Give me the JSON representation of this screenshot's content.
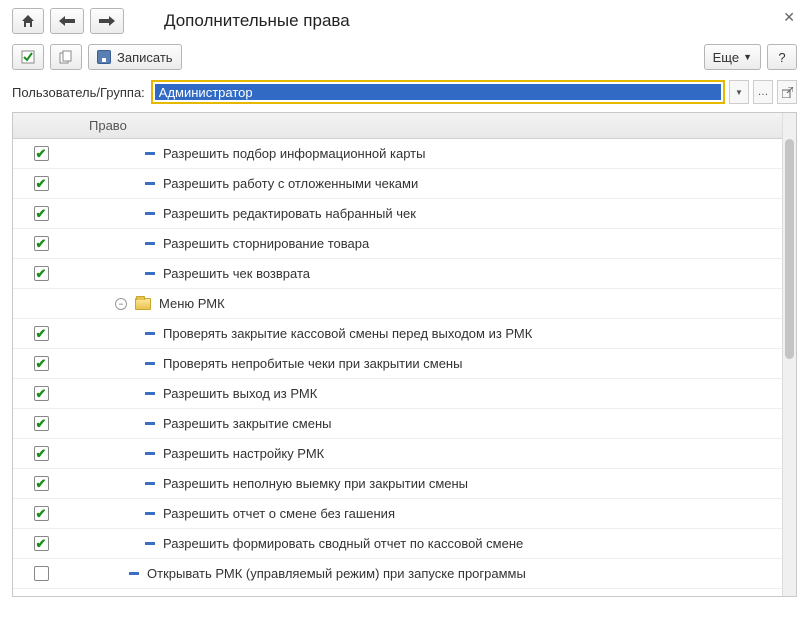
{
  "window": {
    "title": "Дополнительные права"
  },
  "toolbar": {
    "save_label": "Записать",
    "more_label": "Еще"
  },
  "user": {
    "label": "Пользователь/Группа:",
    "value": "Администратор"
  },
  "grid": {
    "header_right": "Право",
    "rows": [
      {
        "type": "leaf",
        "checked": true,
        "indent": 1,
        "label": "Разрешить подбор информационной карты"
      },
      {
        "type": "leaf",
        "checked": true,
        "indent": 1,
        "label": "Разрешить работу с отложенными чеками"
      },
      {
        "type": "leaf",
        "checked": true,
        "indent": 1,
        "label": "Разрешить редактировать набранный чек"
      },
      {
        "type": "leaf",
        "checked": true,
        "indent": 1,
        "label": "Разрешить сторнирование товара"
      },
      {
        "type": "leaf",
        "checked": true,
        "indent": 1,
        "label": "Разрешить чек возврата"
      },
      {
        "type": "folder",
        "label": "Меню РМК",
        "expanded": true
      },
      {
        "type": "leaf",
        "checked": true,
        "indent": 2,
        "label": "Проверять закрытие кассовой смены перед выходом из РМК"
      },
      {
        "type": "leaf",
        "checked": true,
        "indent": 2,
        "label": "Проверять непробитые чеки при закрытии смены"
      },
      {
        "type": "leaf",
        "checked": true,
        "indent": 2,
        "label": "Разрешить выход из РМК"
      },
      {
        "type": "leaf",
        "checked": true,
        "indent": 2,
        "label": "Разрешить закрытие смены"
      },
      {
        "type": "leaf",
        "checked": true,
        "indent": 2,
        "label": "Разрешить настройку РМК"
      },
      {
        "type": "leaf",
        "checked": true,
        "indent": 2,
        "label": "Разрешить неполную выемку при закрытии смены"
      },
      {
        "type": "leaf",
        "checked": true,
        "indent": 2,
        "label": "Разрешить отчет о смене без гашения"
      },
      {
        "type": "leaf",
        "checked": true,
        "indent": 2,
        "label": "Разрешить формировать сводный отчет по кассовой смене"
      },
      {
        "type": "leaf",
        "checked": false,
        "indent": 0,
        "label": "Открывать РМК (управляемый режим) при запуске программы"
      }
    ]
  }
}
